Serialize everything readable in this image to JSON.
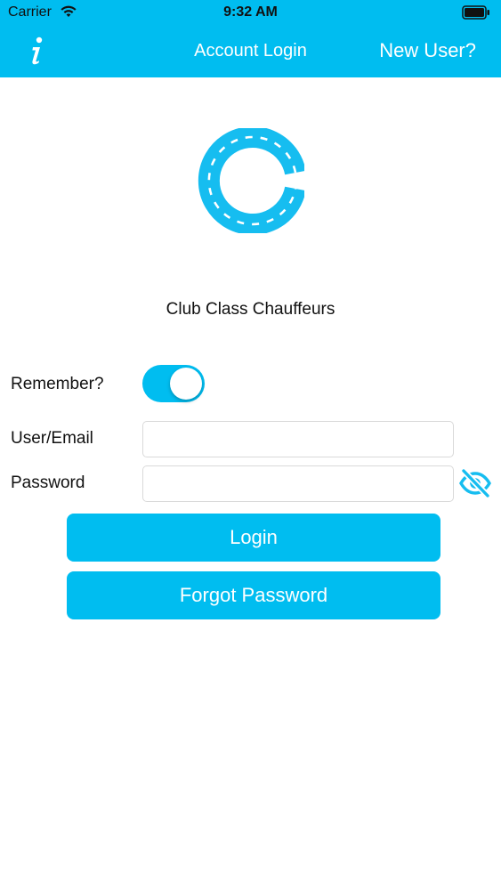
{
  "status_bar": {
    "carrier": "Carrier",
    "time": "9:32 AM",
    "icons": [
      "wifi-icon",
      "battery-icon"
    ]
  },
  "nav": {
    "info_icon": "info-icon",
    "info_glyph": "i",
    "title": "Account Login",
    "new_user": "New User?"
  },
  "brand": {
    "logo_icon": "road-ring-logo",
    "name": "Club Class Chauffeurs"
  },
  "form": {
    "remember_label": "Remember?",
    "remember_on": true,
    "user_label": "User/Email",
    "user_value": "",
    "password_label": "Password",
    "password_value": "",
    "visibility_icon": "eye-slash-icon"
  },
  "buttons": {
    "login": "Login",
    "forgot": "Forgot Password"
  },
  "colors": {
    "accent": "#00bdf0",
    "background": "#ffffff",
    "text": "#111111"
  }
}
